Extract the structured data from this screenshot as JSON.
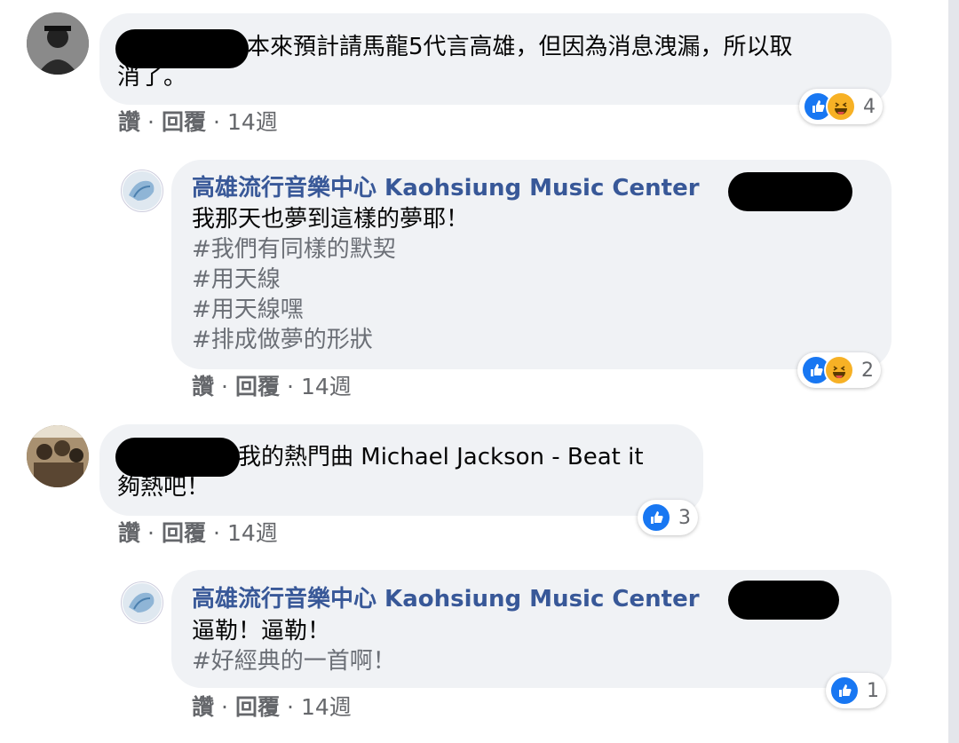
{
  "comments": [
    {
      "text_line1": "本來預計請馬龍5代言高雄，但因為消息洩漏，所以取",
      "text_line2": "消了。",
      "reaction_count": "4",
      "actions": {
        "like": "讚",
        "reply": "回覆",
        "time": "14週"
      }
    },
    {
      "author": "高雄流行音樂中心 Kaohsiung Music Center",
      "lines": [
        "我那天也夢到這樣的夢耶！"
      ],
      "tags": [
        "#我們有同樣的默契",
        "#用天線",
        "#用天線嘿",
        "#排成做夢的形狀"
      ],
      "reaction_count": "2",
      "actions": {
        "like": "讚",
        "reply": "回覆",
        "time": "14週"
      }
    },
    {
      "text_line1": "我的熱門曲 Michael Jackson - Beat it",
      "text_line2": "夠熱吧！",
      "reaction_count": "3",
      "actions": {
        "like": "讚",
        "reply": "回覆",
        "time": "14週"
      }
    },
    {
      "author": "高雄流行音樂中心 Kaohsiung Music Center",
      "lines": [
        "逼勒！逼勒！"
      ],
      "tags": [
        "#好經典的一首啊！"
      ],
      "reaction_count": "1",
      "actions": {
        "like": "讚",
        "reply": "回覆",
        "time": "14週"
      }
    }
  ],
  "icons": {
    "like": "thumbs-up-icon",
    "haha": "laughing-face-icon"
  },
  "colors": {
    "like": "#1877f2",
    "haha": "#f7b125",
    "author": "#385898",
    "bubble": "#f0f2f5"
  }
}
